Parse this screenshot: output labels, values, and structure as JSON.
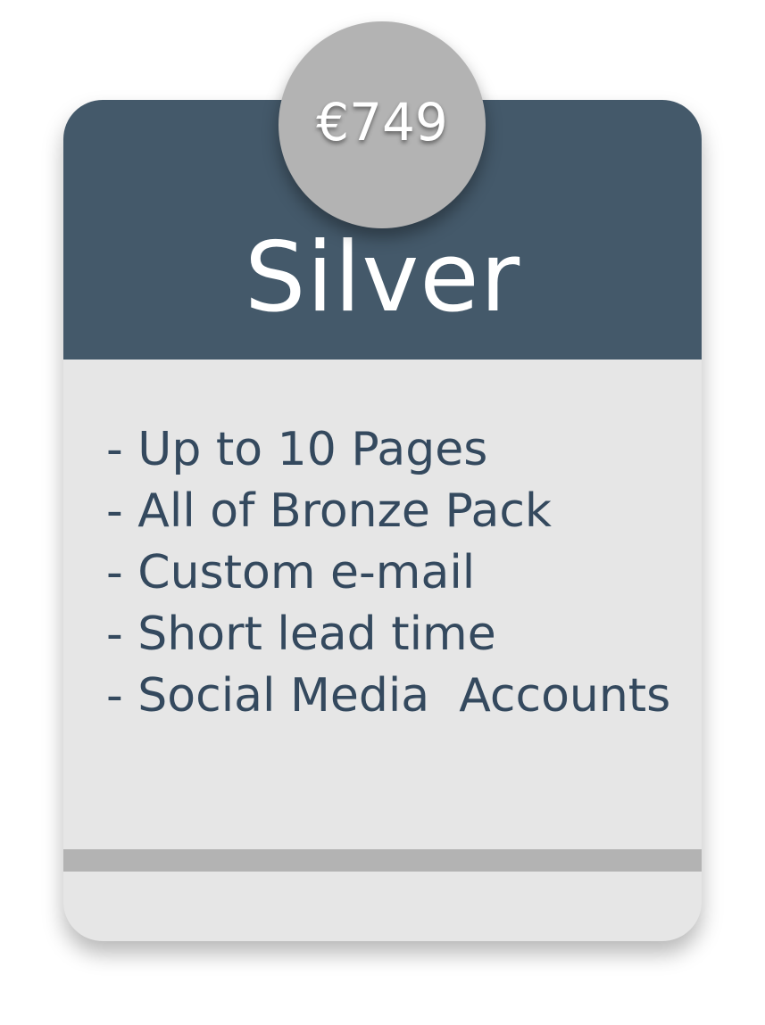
{
  "pricing_card": {
    "price": "€749",
    "plan_name": "Silver",
    "features": [
      "- Up to 10 Pages",
      "- All of Bronze Pack",
      "- Custom e-mail",
      "- Short lead time",
      "- Social Media  Accounts"
    ]
  },
  "colors": {
    "header": "#44596a",
    "body": "#e6e6e6",
    "price_badge": "#b3b3b3",
    "divider": "#b3b3b3",
    "feature_text": "#34495e"
  }
}
